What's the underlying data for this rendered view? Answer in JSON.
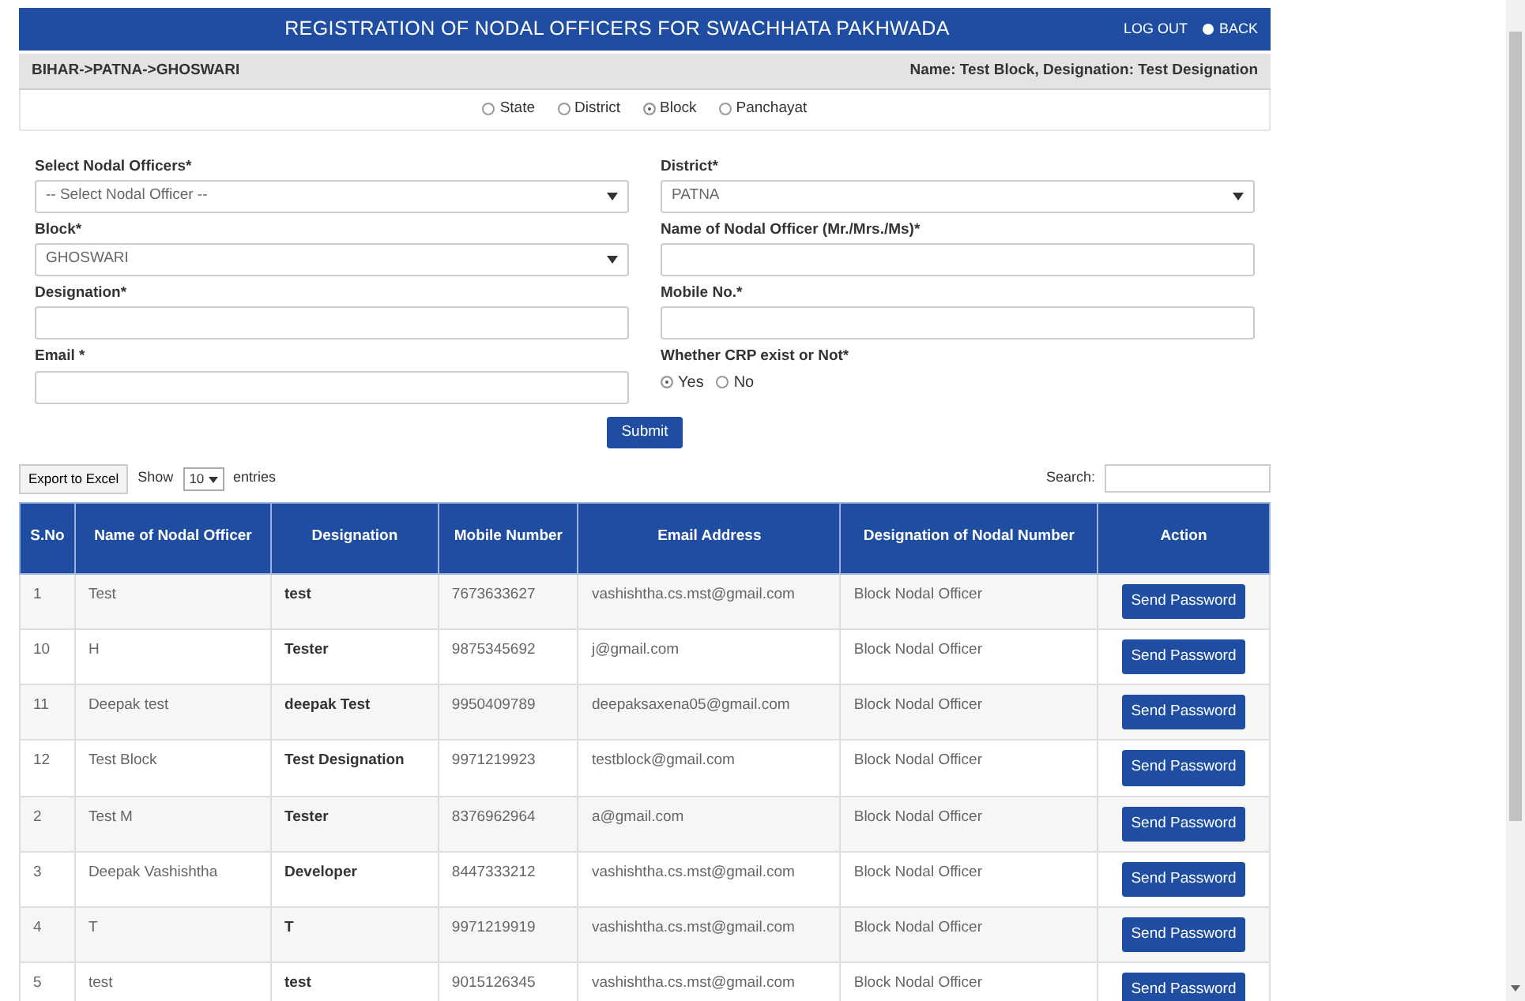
{
  "header": {
    "title": "REGISTRATION OF NODAL OFFICERS FOR SWACHHATA PAKHWADA",
    "links": [
      "LOG OUT",
      "BACK"
    ]
  },
  "info_bar": {
    "breadcrumb": "BIHAR->PATNA->GHOSWARI",
    "user": "Name: Test Block, Designation: Test Designation"
  },
  "levels": [
    {
      "label": "State",
      "selected": false
    },
    {
      "label": "District",
      "selected": false
    },
    {
      "label": "Block",
      "selected": true
    },
    {
      "label": "Panchayat",
      "selected": false
    }
  ],
  "form": {
    "left": [
      {
        "label": "Select Nodal Officers*",
        "kind": "select",
        "value": "-- Select Nodal Officer --"
      },
      {
        "label": "Block*",
        "kind": "select",
        "value": "GHOSWARI"
      },
      {
        "label": "Designation*",
        "kind": "text"
      },
      {
        "label": "Email *",
        "kind": "text"
      }
    ],
    "right": [
      {
        "label": "District*",
        "kind": "select",
        "value": "PATNA"
      },
      {
        "label": "Name of Nodal Officer (Mr./Mrs./Ms)*",
        "kind": "text"
      },
      {
        "label": "Mobile No.*",
        "kind": "text"
      },
      {
        "label": "Whether CRP exist or Not*",
        "kind": "radio",
        "options": [
          {
            "label": "Yes",
            "selected": true
          },
          {
            "label": "No",
            "selected": false
          }
        ]
      }
    ],
    "submit": "Submit"
  },
  "table_tools": {
    "export": "Export to Excel",
    "show": "Show",
    "page_size": "10",
    "entries": "entries",
    "search_label": "Search:"
  },
  "table": {
    "columns": [
      "S.No",
      "Name of Nodal Officer",
      "Designation",
      "Mobile Number",
      "Email Address",
      "Designation of Nodal Number",
      "Action"
    ],
    "rows": [
      [
        "1",
        "Test",
        "test",
        "7673633627",
        "vashishtha.cs.mst@gmail.com",
        "Block Nodal Officer",
        "Send Password"
      ],
      [
        "10",
        "H",
        "Tester",
        "9875345692",
        "j@gmail.com",
        "Block Nodal Officer",
        "Send Password"
      ],
      [
        "11",
        "Deepak test",
        "deepak Test",
        "9950409789",
        "deepaksaxena05@gmail.com",
        "Block Nodal Officer",
        "Send Password"
      ],
      [
        "12",
        "Test Block",
        "Test Designation",
        "9971219923",
        "testblock@gmail.com",
        "Block Nodal Officer",
        "Send Password"
      ],
      [
        "2",
        "Test M",
        "Tester",
        "8376962964",
        "a@gmail.com",
        "Block Nodal Officer",
        "Send Password"
      ],
      [
        "3",
        "Deepak Vashishtha",
        "Developer",
        "8447333212",
        "vashishtha.cs.mst@gmail.com",
        "Block Nodal Officer",
        "Send Password"
      ],
      [
        "4",
        "T",
        "T",
        "9971219919",
        "vashishtha.cs.mst@gmail.com",
        "Block Nodal Officer",
        "Send Password"
      ],
      [
        "5",
        "test",
        "test",
        "9015126345",
        "vashishtha.cs.mst@gmail.com",
        "Block Nodal Officer",
        "Send Password"
      ]
    ]
  }
}
